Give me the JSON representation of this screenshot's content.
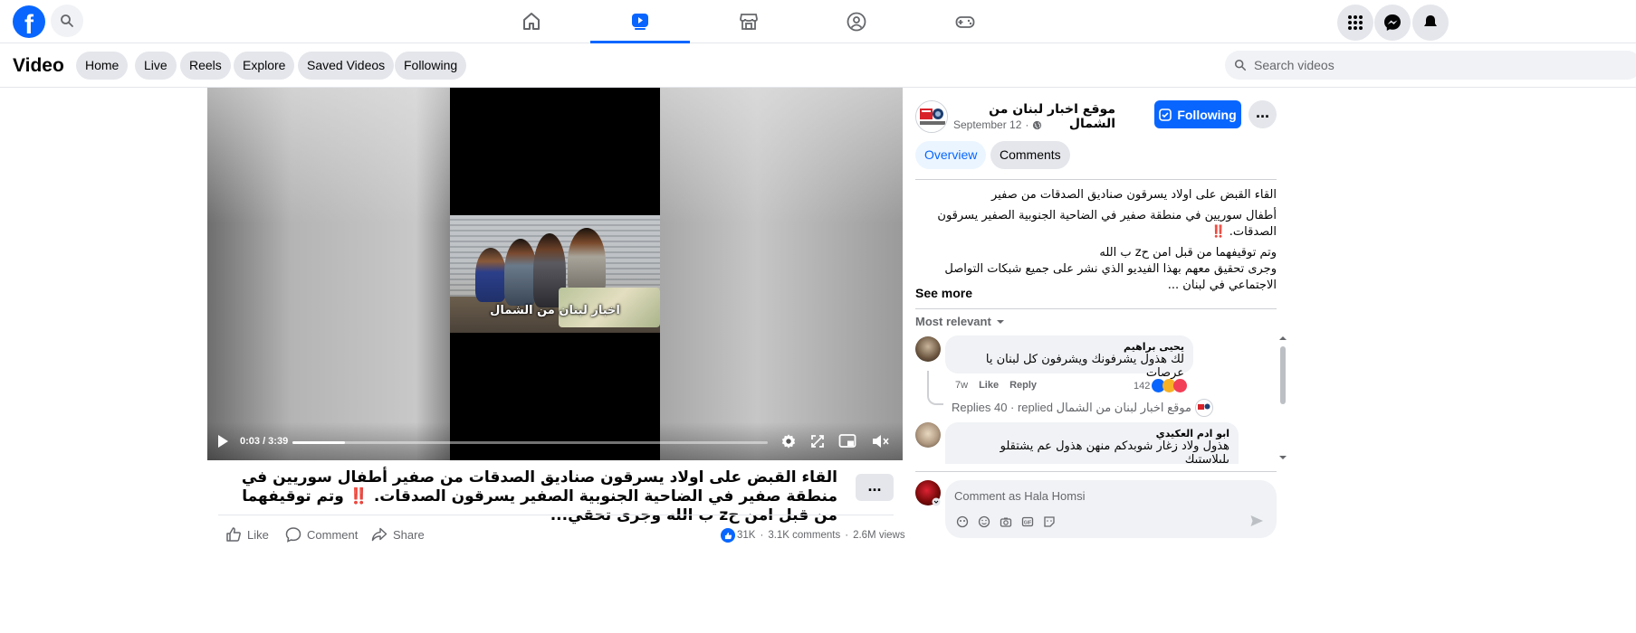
{
  "topnav": {
    "logo_letter": "f",
    "tabs": [
      "home-icon",
      "video-icon",
      "marketplace-icon",
      "groups-icon",
      "gaming-icon"
    ],
    "active_tab": "video-icon"
  },
  "subheader": {
    "title": "Video",
    "chips": [
      "Home",
      "Live",
      "Reels",
      "Explore",
      "Saved Videos",
      "Following"
    ],
    "search_placeholder": "Search videos"
  },
  "player": {
    "time": "0:03 / 3:39",
    "progress_fraction": 0.11,
    "frame_caption": "اخبار لبنان من الشمال"
  },
  "video": {
    "title_part1": "القاء القبض على اولاد يسرقون صناديق الصدقات من صفير أطفال سوريين في منطقة صفير في الضاحية الجنوبية الصفير يسرقون الصدقات.",
    "title_alarm": "‼️",
    "title_part2": "وتم توقيفهما من قبل امن حz ب الله وجرى تحقي...",
    "more_label": "...",
    "actions": {
      "like": "Like",
      "comment": "Comment",
      "share": "Share"
    },
    "stats": {
      "reactions": "31K",
      "comments": "3.1K comments",
      "views": "2.6M views",
      "separator": "·"
    }
  },
  "panel": {
    "page_name": "موقع اخبار لبنان من الشمال",
    "date": "September 12",
    "date_separator": "·",
    "follow_label": "Following",
    "more_label": "...",
    "tabs": {
      "overview": "Overview",
      "comments": "Comments"
    },
    "description": [
      "القاء القبض على اولاد يسرقون صناديق الصدقات من صفير",
      "أطفال سوريين في منطقة صفير في الضاحية الجنوبية الصفير يسرقون الصدقات. ‼️",
      "وتم توقيفهما من قبل امن حz ب الله",
      "وجرى تحقيق معهم بهذا الفيديو الذي نشر على جميع شبكات التواصل الاجتماعي في لبنان ..."
    ],
    "see_more": "See more",
    "sort_label": "Most relevant",
    "comments": [
      {
        "author": "يحيى براهيم",
        "text": "لك هذول يشرفونك ويشرفون كل لبنان يا عرصات",
        "time": "7w",
        "like": "Like",
        "reply": "Reply",
        "reactions": "142"
      },
      {
        "author": "ابو ادم العكيدي",
        "text": "هذول ولاد زغار شوبدكم منهن هذول عم يشتقلو بلبلاستيك"
      }
    ],
    "replies_text": "Replies 40 · replied موقع اخبار لبنان من الشمال",
    "compose_placeholder": "Comment as Hala Homsi"
  }
}
